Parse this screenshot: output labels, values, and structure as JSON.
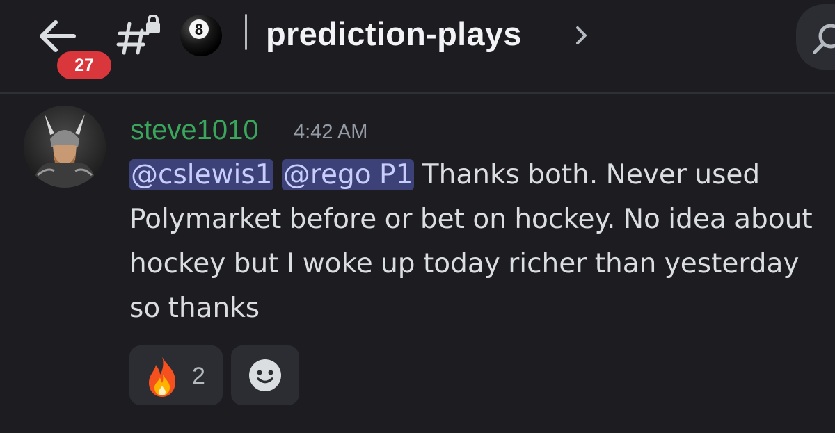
{
  "header": {
    "unread_count": "27",
    "channel_emoji": "8ball",
    "channel_name": "prediction-plays"
  },
  "message": {
    "author": "steve1010",
    "author_color": "#3ba55c",
    "timestamp": "4:42 AM",
    "mentions": [
      "@cslewis1",
      "@rego P1"
    ],
    "text": " Thanks both.  Never used Polymarket before or bet on hockey.  No idea about hockey but I woke up today richer than yesterday so thanks"
  },
  "reactions": [
    {
      "emoji": "fire-icon",
      "count": "2"
    }
  ],
  "icons": {
    "back": "back-arrow-icon",
    "channel": "locked-text-channel-icon",
    "chevron": "chevron-right-icon",
    "search": "search-icon",
    "add_reaction": "add-reaction-icon"
  },
  "colors": {
    "background": "#1c1c21",
    "badge": "#da373c",
    "mention_bg": "#3c4178",
    "mention_text": "#c9cdfb"
  }
}
